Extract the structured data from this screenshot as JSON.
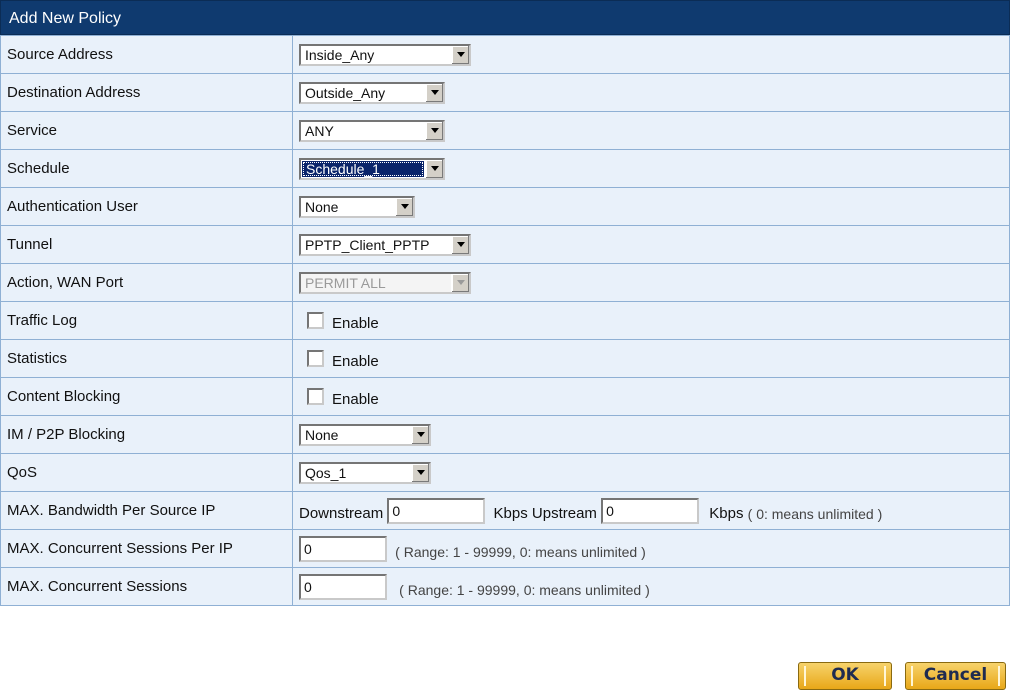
{
  "title": "Add New Policy",
  "fields": {
    "source_address": {
      "label": "Source Address",
      "value": "Inside_Any"
    },
    "destination_address": {
      "label": "Destination Address",
      "value": "Outside_Any"
    },
    "service": {
      "label": "Service",
      "value": "ANY"
    },
    "schedule": {
      "label": "Schedule",
      "value": "Schedule_1"
    },
    "auth_user": {
      "label": "Authentication User",
      "value": "None"
    },
    "tunnel": {
      "label": "Tunnel",
      "value": "PPTP_Client_PPTP"
    },
    "action": {
      "label": "Action, WAN Port",
      "value": "PERMIT ALL"
    },
    "traffic_log": {
      "label": "Traffic Log",
      "checkbox": "Enable"
    },
    "statistics": {
      "label": "Statistics",
      "checkbox": "Enable"
    },
    "content_blocking": {
      "label": "Content Blocking",
      "checkbox": "Enable"
    },
    "im_p2p": {
      "label": "IM / P2P Blocking",
      "value": "None"
    },
    "qos": {
      "label": "QoS",
      "value": "Qos_1"
    },
    "bandwidth": {
      "label": "MAX. Bandwidth Per Source IP",
      "downstream_label": "Downstream",
      "downstream_value": "0",
      "upstream_label": "Kbps Upstream",
      "upstream_value": "0",
      "kbps": "Kbps",
      "note": "( 0: means unlimited )"
    },
    "sessions_per_ip": {
      "label": "MAX. Concurrent Sessions Per IP",
      "value": "0",
      "note": "( Range: 1 - 99999, 0: means unlimited )"
    },
    "sessions": {
      "label": "MAX. Concurrent Sessions",
      "value": "0",
      "note": "( Range: 1 - 99999, 0: means unlimited )"
    }
  },
  "buttons": {
    "ok": "OK",
    "cancel": "Cancel"
  }
}
